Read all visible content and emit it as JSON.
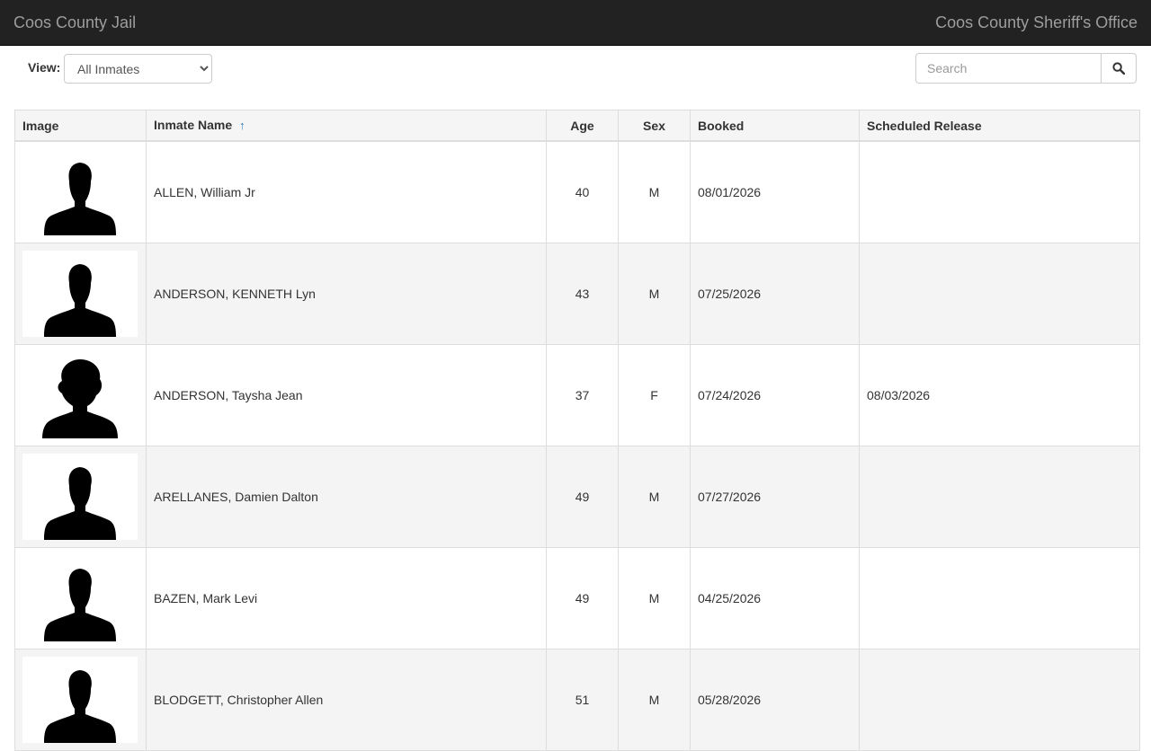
{
  "navbar": {
    "brand": "Coos County Jail",
    "agency": "Coos County Sheriff's Office"
  },
  "filter": {
    "view_label": "View:",
    "view_selected": "All Inmates"
  },
  "search": {
    "placeholder": "Search",
    "button_icon": "search-icon"
  },
  "table": {
    "headers": {
      "image": "Image",
      "name": "Inmate Name",
      "name_sort_icon": "sort-ascending-icon",
      "age": "Age",
      "sex": "Sex",
      "booked": "Booked",
      "release": "Scheduled Release"
    },
    "rows": [
      {
        "photo": "male-silhouette-icon",
        "name": "ALLEN, William Jr",
        "age": "40",
        "sex": "M",
        "booked": "08/01/2026",
        "release": ""
      },
      {
        "photo": "male-silhouette-icon",
        "name": "ANDERSON, KENNETH Lyn",
        "age": "43",
        "sex": "M",
        "booked": "07/25/2026",
        "release": ""
      },
      {
        "photo": "female-silhouette-icon",
        "name": "ANDERSON, Taysha Jean",
        "age": "37",
        "sex": "F",
        "booked": "07/24/2026",
        "release": "08/03/2026"
      },
      {
        "photo": "male-silhouette-icon",
        "name": "ARELLANES, Damien Dalton",
        "age": "49",
        "sex": "M",
        "booked": "07/27/2026",
        "release": ""
      },
      {
        "photo": "male-silhouette-icon",
        "name": "BAZEN, Mark Levi",
        "age": "49",
        "sex": "M",
        "booked": "04/25/2026",
        "release": ""
      },
      {
        "photo": "male-silhouette-icon",
        "name": "BLODGETT, Christopher Allen",
        "age": "51",
        "sex": "M",
        "booked": "05/28/2026",
        "release": ""
      }
    ]
  }
}
